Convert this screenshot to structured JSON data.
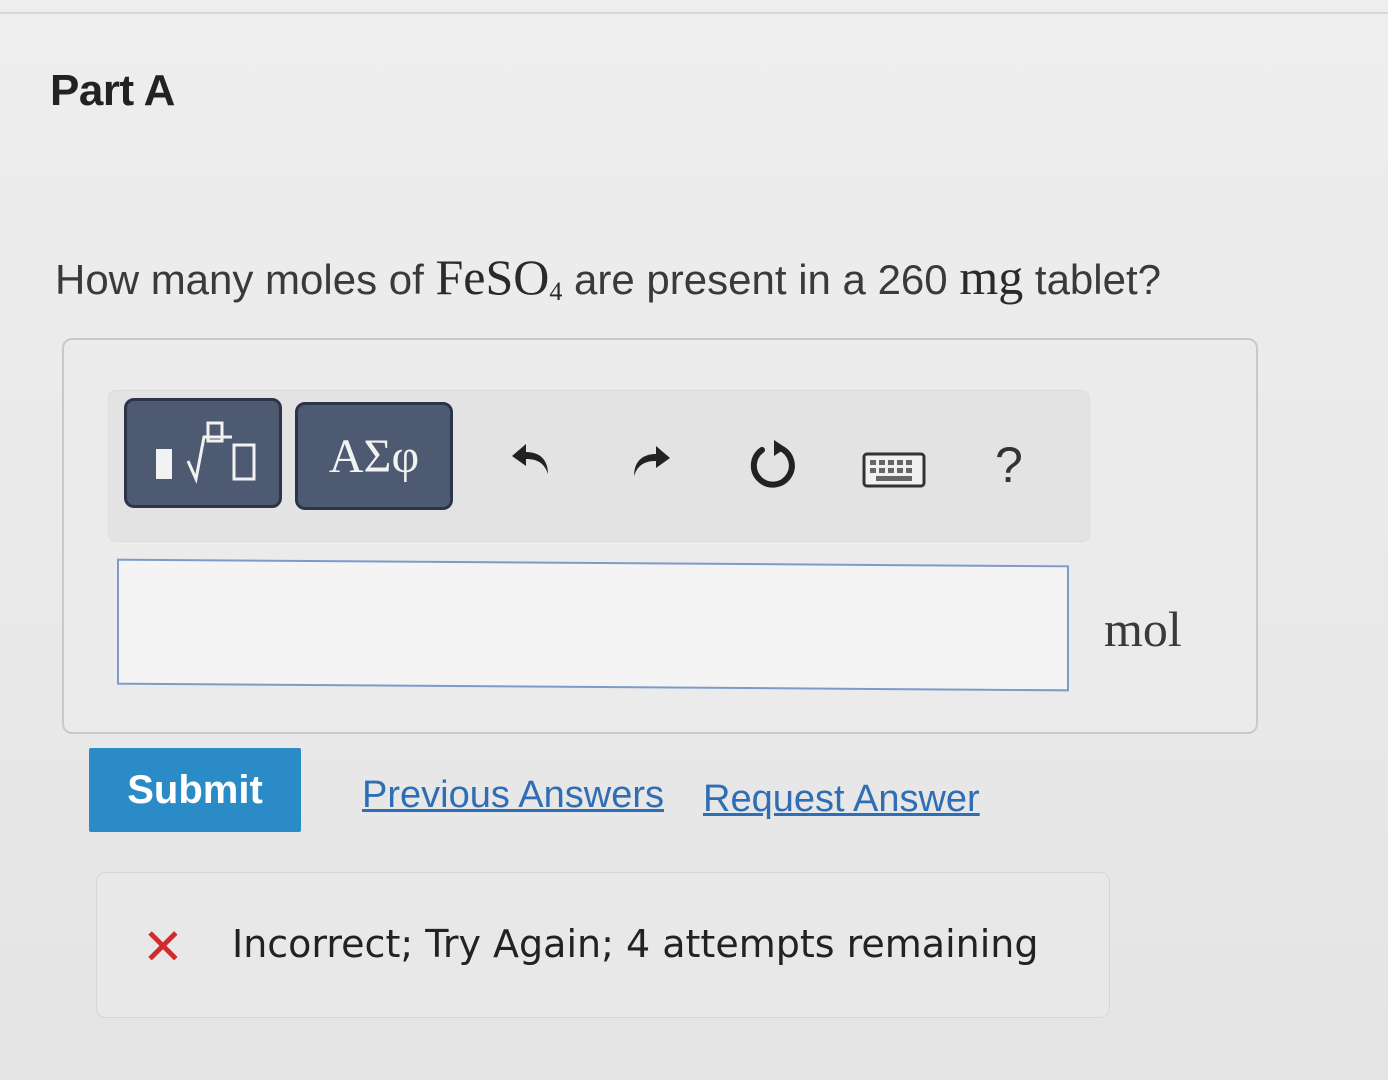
{
  "part": {
    "title": "Part A"
  },
  "question": {
    "prefix": "How many moles of ",
    "formula_main": "FeSO",
    "formula_subscript": "4",
    "middle": " are present in a 260 ",
    "unit_inline": "mg",
    "suffix": " tablet?"
  },
  "toolbar": {
    "symbols_label": "ΑΣφ",
    "help_label": "?",
    "icons": [
      "templates-icon",
      "undo-icon",
      "redo-icon",
      "reset-icon",
      "keyboard-icon",
      "help-icon"
    ]
  },
  "answer": {
    "value": "",
    "unit": "mol"
  },
  "actions": {
    "submit_label": "Submit",
    "previous_answers_label": "Previous Answers",
    "request_answer_label": "Request Answer"
  },
  "feedback": {
    "status": "incorrect",
    "message": "Incorrect; Try Again; 4 attempts remaining"
  },
  "colors": {
    "submit_bg": "#2a8bc6",
    "link": "#2f6db4",
    "error": "#d12b2b",
    "toolbar_button": "#4d5a72",
    "input_border": "#7a9cc7"
  }
}
